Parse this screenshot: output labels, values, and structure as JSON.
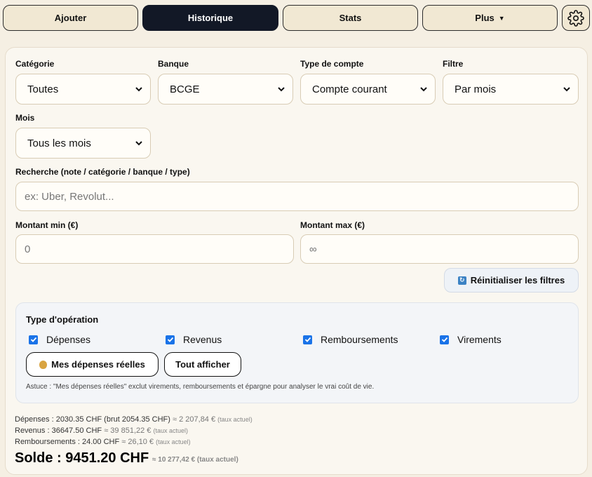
{
  "nav": {
    "tabs": [
      {
        "label": "Ajouter"
      },
      {
        "label": "Historique"
      },
      {
        "label": "Stats"
      },
      {
        "label": "Plus"
      }
    ],
    "active_tab": "Historique"
  },
  "filters": {
    "categorie": {
      "label": "Catégorie",
      "value": "Toutes"
    },
    "banque": {
      "label": "Banque",
      "value": "BCGE"
    },
    "type_compte": {
      "label": "Type de compte",
      "value": "Compte courant"
    },
    "filtre": {
      "label": "Filtre",
      "value": "Par mois"
    },
    "mois": {
      "label": "Mois",
      "value": "Tous les mois"
    },
    "recherche": {
      "label": "Recherche (note / catégorie / banque / type)",
      "placeholder": "ex: Uber, Revolut..."
    },
    "montant_min": {
      "label": "Montant min (€)",
      "placeholder": "0"
    },
    "montant_max": {
      "label": "Montant max (€)",
      "placeholder": "∞"
    },
    "reset_label": "Réinitialiser les filtres"
  },
  "operations": {
    "title": "Type d'opération",
    "checkboxes": [
      {
        "label": "Dépenses",
        "checked": true
      },
      {
        "label": "Revenus",
        "checked": true
      },
      {
        "label": "Remboursements",
        "checked": true
      },
      {
        "label": "Virements",
        "checked": true
      }
    ],
    "mes_depenses_label": "Mes dépenses réelles",
    "tout_afficher_label": "Tout afficher",
    "tip": "Astuce : \"Mes dépenses réelles\" exclut virements, remboursements et épargne pour analyser le vrai coût de vie."
  },
  "summary": {
    "depenses": "Dépenses : 2030.35 CHF (brut 2054.35 CHF)",
    "depenses_approx": "≈ 2 207,84 €",
    "revenus": "Revenus : 36647.50 CHF",
    "revenus_approx": "≈ 39 851,22 €",
    "remboursements": "Remboursements : 24.00 CHF",
    "remboursements_approx": "≈ 26,10 €",
    "taux": "(taux actuel)",
    "solde": "Solde : 9451.20 CHF",
    "solde_approx": "≈ 10 277,42 €"
  },
  "colors": {
    "accent": "#1a73e8",
    "active_tab": "#121826",
    "background": "#f5efe3"
  }
}
